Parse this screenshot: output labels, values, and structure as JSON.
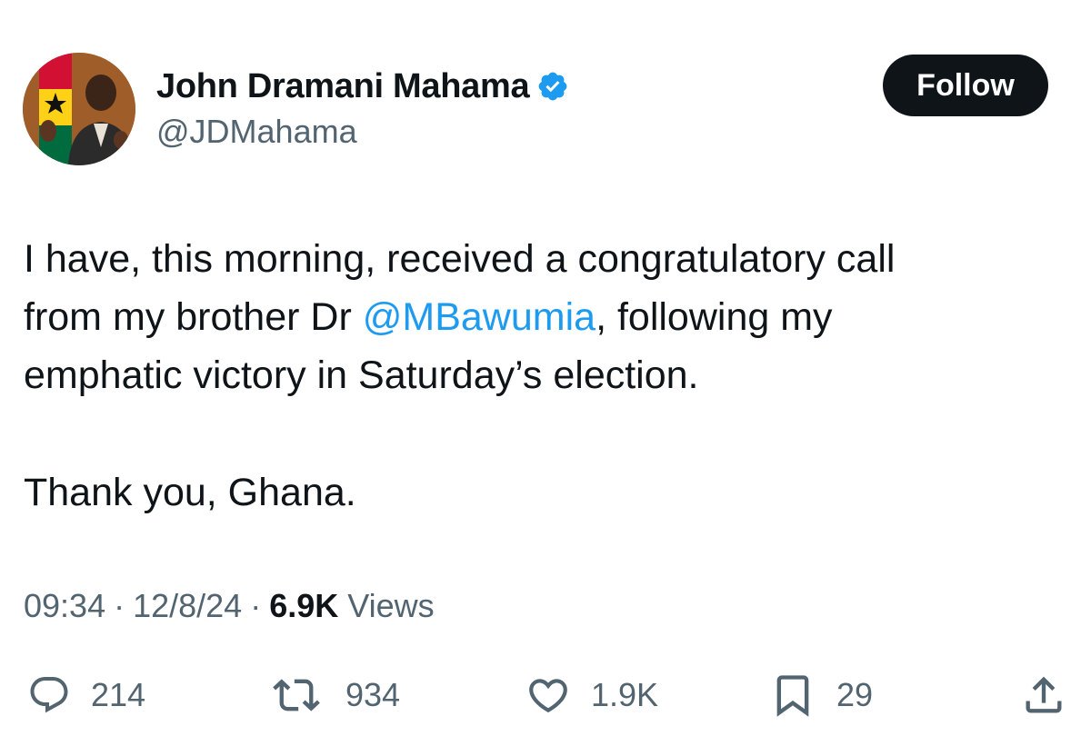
{
  "author": {
    "display_name": "John Dramani Mahama",
    "handle": "@JDMahama",
    "verified": true,
    "verified_icon": "verified-badge-icon"
  },
  "follow_label": "Follow",
  "tweet": {
    "line1": "I have, this morning, received a congratulatory call",
    "line2_prefix": "from my brother Dr ",
    "mention": "@MBawumia",
    "line2_suffix": ", following my",
    "line3": "emphatic victory in Saturday’s election.",
    "line4": "Thank you, Ghana."
  },
  "meta": {
    "time": "09:34",
    "date": "12/8/24",
    "separator": "·",
    "views_count": "6.9K",
    "views_label": "Views"
  },
  "actions": {
    "replies": "214",
    "reposts": "934",
    "likes": "1.9K",
    "bookmarks": "29"
  },
  "colors": {
    "text": "#0f1419",
    "secondary": "#536471",
    "link": "#1d9bf0",
    "follow_bg": "#0f1419",
    "verified": "#1d9bf0"
  }
}
